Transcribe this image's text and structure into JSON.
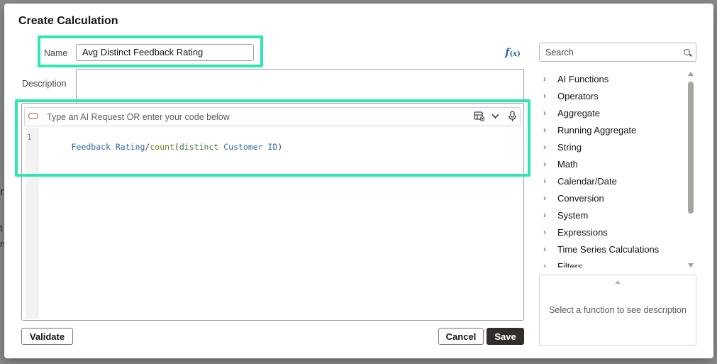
{
  "dialog": {
    "title": "Create Calculation"
  },
  "name_field": {
    "label": "Name",
    "value": "Avg Distinct Feedback Rating"
  },
  "description_field": {
    "label": "Description",
    "value": ""
  },
  "editor": {
    "ai_placeholder": "Type an AI Request OR enter your code below",
    "line_number": "1",
    "code_tokens": [
      {
        "text": "Feedback Rating",
        "kind": "field"
      },
      {
        "text": "/",
        "kind": "plain"
      },
      {
        "text": "count",
        "kind": "fn"
      },
      {
        "text": "(",
        "kind": "plain"
      },
      {
        "text": "distinct",
        "kind": "kw"
      },
      {
        "text": " ",
        "kind": "plain"
      },
      {
        "text": "Customer ID",
        "kind": "field"
      },
      {
        "text": ")",
        "kind": "plain"
      }
    ]
  },
  "buttons": {
    "validate": "Validate",
    "cancel": "Cancel",
    "save": "Save"
  },
  "search": {
    "placeholder": "Search"
  },
  "function_categories": [
    "AI Functions",
    "Operators",
    "Aggregate",
    "Running Aggregate",
    "String",
    "Math",
    "Calendar/Date",
    "Conversion",
    "System",
    "Expressions",
    "Time Series Calculations",
    "Filters"
  ],
  "description_panel": {
    "text": "Select a function to see description"
  },
  "background_fragments": [
    "n",
    "t",
    "n"
  ],
  "colors": {
    "highlight": "#2ee6b4",
    "primary_button": "#312d2a",
    "field_token": "#2b6aa3",
    "function_token": "#6b7f1b",
    "ai_icon": "#c74634"
  },
  "icons": {
    "fx": "function-fx-icon",
    "ai": "ai-assistant-icon",
    "data": "insert-data-icon",
    "expand": "chevron-down-icon",
    "mic": "microphone-icon",
    "search": "search-icon"
  }
}
